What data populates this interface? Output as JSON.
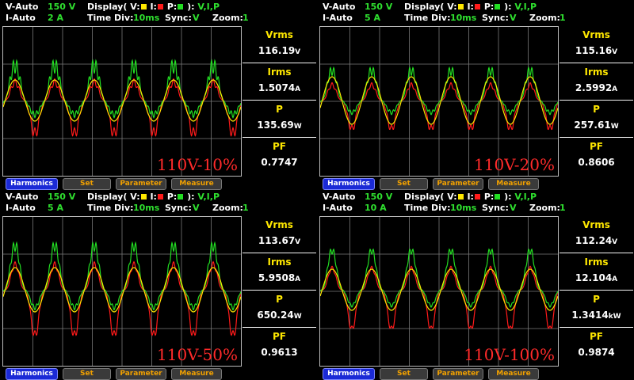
{
  "colors": {
    "voltage": "#ffe800",
    "current": "#ff1a1a",
    "power": "#22dd22",
    "label": "#2fe02f",
    "button_orange": "#f0a000",
    "button_blue": "#1b2ad6"
  },
  "panels": [
    {
      "v_mode": "V-Auto",
      "v_range": "150 V",
      "i_mode": "I-Auto",
      "i_range": "2 A",
      "display_label": "Display( V:",
      "display_i": "I:",
      "display_p": "P:",
      "display_end": "):",
      "display_value": "V,I,P",
      "timediv_label": "Time  Div:",
      "timediv_value": "10ms",
      "sync_label": "Sync:",
      "sync_value": "V",
      "zoom_label": "Zoom:",
      "zoom_value": "1",
      "load_label": "110V-10%",
      "vrms_label": "Vrms",
      "vrms_value": "116.19",
      "vrms_unit": "V",
      "irms_label": "Irms",
      "irms_value": "1.5074",
      "irms_unit": "A",
      "p_label": "P",
      "p_value": "135.69",
      "p_unit": "W",
      "pf_label": "PF",
      "pf_value": "0.7747",
      "buttons": {
        "harmonics": "Harmonics",
        "set": "Set",
        "parameter": "Parameter",
        "measure": "Measure"
      }
    },
    {
      "v_mode": "V-Auto",
      "v_range": "150 V",
      "i_mode": "I-Auto",
      "i_range": "5 A",
      "display_label": "Display( V:",
      "display_i": "I:",
      "display_p": "P:",
      "display_end": "):",
      "display_value": "V,I,P",
      "timediv_label": "Time  Div:",
      "timediv_value": "10ms",
      "sync_label": "Sync:",
      "sync_value": "V",
      "zoom_label": "Zoom:",
      "zoom_value": "1",
      "load_label": "110V-20%",
      "vrms_label": "Vrms",
      "vrms_value": "115.16",
      "vrms_unit": "V",
      "irms_label": "Irms",
      "irms_value": "2.5992",
      "irms_unit": "A",
      "p_label": "P",
      "p_value": "257.61",
      "p_unit": "W",
      "pf_label": "PF",
      "pf_value": "0.8606",
      "buttons": {
        "harmonics": "Harmonics",
        "set": "Set",
        "parameter": "Parameter",
        "measure": "Measure"
      }
    },
    {
      "v_mode": "V-Auto",
      "v_range": "150 V",
      "i_mode": "I-Auto",
      "i_range": "5 A",
      "display_label": "Display( V:",
      "display_i": "I:",
      "display_p": "P:",
      "display_end": "):",
      "display_value": "V,I,P",
      "timediv_label": "Time  Div:",
      "timediv_value": "10ms",
      "sync_label": "Sync:",
      "sync_value": "V",
      "zoom_label": "Zoom:",
      "zoom_value": "1",
      "load_label": "110V-50%",
      "vrms_label": "Vrms",
      "vrms_value": "113.67",
      "vrms_unit": "V",
      "irms_label": "Irms",
      "irms_value": "5.9508",
      "irms_unit": "A",
      "p_label": "P",
      "p_value": "650.24",
      "p_unit": "W",
      "pf_label": "PF",
      "pf_value": "0.9613",
      "buttons": {
        "harmonics": "Harmonics",
        "set": "Set",
        "parameter": "Parameter",
        "measure": "Measure"
      }
    },
    {
      "v_mode": "V-Auto",
      "v_range": "150 V",
      "i_mode": "I-Auto",
      "i_range": "10 A",
      "display_label": "Display( V:",
      "display_i": "I:",
      "display_p": "P:",
      "display_end": "):",
      "display_value": "V,I,P",
      "timediv_label": "Time  Div:",
      "timediv_value": "10ms",
      "sync_label": "Sync:",
      "sync_value": "V",
      "zoom_label": "Zoom:",
      "zoom_value": "1",
      "load_label": "110V-100%",
      "vrms_label": "Vrms",
      "vrms_value": "112.24",
      "vrms_unit": "V",
      "irms_label": "Irms",
      "irms_value": "12.104",
      "irms_unit": "A",
      "p_label": "P",
      "p_value": "1.3414",
      "p_unit": "kW",
      "pf_label": "PF",
      "pf_value": "0.9874",
      "buttons": {
        "harmonics": "Harmonics",
        "set": "Set",
        "parameter": "Parameter",
        "measure": "Measure"
      }
    }
  ]
}
